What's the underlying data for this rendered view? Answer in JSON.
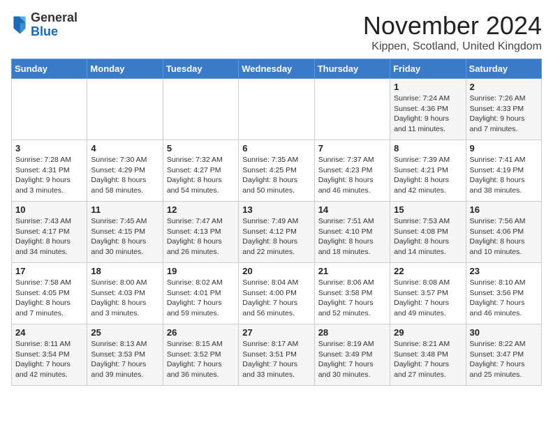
{
  "logo": {
    "general": "General",
    "blue": "Blue"
  },
  "header": {
    "month_year": "November 2024",
    "location": "Kippen, Scotland, United Kingdom"
  },
  "days_of_week": [
    "Sunday",
    "Monday",
    "Tuesday",
    "Wednesday",
    "Thursday",
    "Friday",
    "Saturday"
  ],
  "weeks": [
    [
      {
        "day": "",
        "info": ""
      },
      {
        "day": "",
        "info": ""
      },
      {
        "day": "",
        "info": ""
      },
      {
        "day": "",
        "info": ""
      },
      {
        "day": "",
        "info": ""
      },
      {
        "day": "1",
        "info": "Sunrise: 7:24 AM\nSunset: 4:36 PM\nDaylight: 9 hours and 11 minutes."
      },
      {
        "day": "2",
        "info": "Sunrise: 7:26 AM\nSunset: 4:33 PM\nDaylight: 9 hours and 7 minutes."
      }
    ],
    [
      {
        "day": "3",
        "info": "Sunrise: 7:28 AM\nSunset: 4:31 PM\nDaylight: 9 hours and 3 minutes."
      },
      {
        "day": "4",
        "info": "Sunrise: 7:30 AM\nSunset: 4:29 PM\nDaylight: 8 hours and 58 minutes."
      },
      {
        "day": "5",
        "info": "Sunrise: 7:32 AM\nSunset: 4:27 PM\nDaylight: 8 hours and 54 minutes."
      },
      {
        "day": "6",
        "info": "Sunrise: 7:35 AM\nSunset: 4:25 PM\nDaylight: 8 hours and 50 minutes."
      },
      {
        "day": "7",
        "info": "Sunrise: 7:37 AM\nSunset: 4:23 PM\nDaylight: 8 hours and 46 minutes."
      },
      {
        "day": "8",
        "info": "Sunrise: 7:39 AM\nSunset: 4:21 PM\nDaylight: 8 hours and 42 minutes."
      },
      {
        "day": "9",
        "info": "Sunrise: 7:41 AM\nSunset: 4:19 PM\nDaylight: 8 hours and 38 minutes."
      }
    ],
    [
      {
        "day": "10",
        "info": "Sunrise: 7:43 AM\nSunset: 4:17 PM\nDaylight: 8 hours and 34 minutes."
      },
      {
        "day": "11",
        "info": "Sunrise: 7:45 AM\nSunset: 4:15 PM\nDaylight: 8 hours and 30 minutes."
      },
      {
        "day": "12",
        "info": "Sunrise: 7:47 AM\nSunset: 4:13 PM\nDaylight: 8 hours and 26 minutes."
      },
      {
        "day": "13",
        "info": "Sunrise: 7:49 AM\nSunset: 4:12 PM\nDaylight: 8 hours and 22 minutes."
      },
      {
        "day": "14",
        "info": "Sunrise: 7:51 AM\nSunset: 4:10 PM\nDaylight: 8 hours and 18 minutes."
      },
      {
        "day": "15",
        "info": "Sunrise: 7:53 AM\nSunset: 4:08 PM\nDaylight: 8 hours and 14 minutes."
      },
      {
        "day": "16",
        "info": "Sunrise: 7:56 AM\nSunset: 4:06 PM\nDaylight: 8 hours and 10 minutes."
      }
    ],
    [
      {
        "day": "17",
        "info": "Sunrise: 7:58 AM\nSunset: 4:05 PM\nDaylight: 8 hours and 7 minutes."
      },
      {
        "day": "18",
        "info": "Sunrise: 8:00 AM\nSunset: 4:03 PM\nDaylight: 8 hours and 3 minutes."
      },
      {
        "day": "19",
        "info": "Sunrise: 8:02 AM\nSunset: 4:01 PM\nDaylight: 7 hours and 59 minutes."
      },
      {
        "day": "20",
        "info": "Sunrise: 8:04 AM\nSunset: 4:00 PM\nDaylight: 7 hours and 56 minutes."
      },
      {
        "day": "21",
        "info": "Sunrise: 8:06 AM\nSunset: 3:58 PM\nDaylight: 7 hours and 52 minutes."
      },
      {
        "day": "22",
        "info": "Sunrise: 8:08 AM\nSunset: 3:57 PM\nDaylight: 7 hours and 49 minutes."
      },
      {
        "day": "23",
        "info": "Sunrise: 8:10 AM\nSunset: 3:56 PM\nDaylight: 7 hours and 46 minutes."
      }
    ],
    [
      {
        "day": "24",
        "info": "Sunrise: 8:11 AM\nSunset: 3:54 PM\nDaylight: 7 hours and 42 minutes."
      },
      {
        "day": "25",
        "info": "Sunrise: 8:13 AM\nSunset: 3:53 PM\nDaylight: 7 hours and 39 minutes."
      },
      {
        "day": "26",
        "info": "Sunrise: 8:15 AM\nSunset: 3:52 PM\nDaylight: 7 hours and 36 minutes."
      },
      {
        "day": "27",
        "info": "Sunrise: 8:17 AM\nSunset: 3:51 PM\nDaylight: 7 hours and 33 minutes."
      },
      {
        "day": "28",
        "info": "Sunrise: 8:19 AM\nSunset: 3:49 PM\nDaylight: 7 hours and 30 minutes."
      },
      {
        "day": "29",
        "info": "Sunrise: 8:21 AM\nSunset: 3:48 PM\nDaylight: 7 hours and 27 minutes."
      },
      {
        "day": "30",
        "info": "Sunrise: 8:22 AM\nSunset: 3:47 PM\nDaylight: 7 hours and 25 minutes."
      }
    ]
  ]
}
